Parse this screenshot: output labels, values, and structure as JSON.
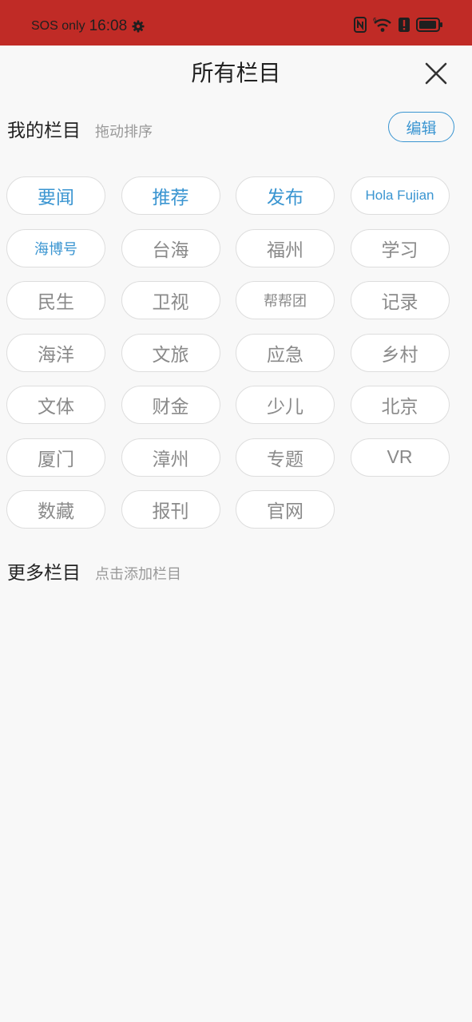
{
  "status_bar": {
    "carrier": "SOS only",
    "time": "16:08"
  },
  "header": {
    "title": "所有栏目"
  },
  "my_channels": {
    "title": "我的栏目",
    "hint": "拖动排序",
    "edit_label": "编辑",
    "items": [
      {
        "label": "要闻",
        "active": true
      },
      {
        "label": "推荐",
        "active": true
      },
      {
        "label": "发布",
        "active": true
      },
      {
        "label": "Hola Fujian",
        "active": true
      },
      {
        "label": "海博号",
        "active": true
      },
      {
        "label": "台海",
        "active": false
      },
      {
        "label": "福州",
        "active": false
      },
      {
        "label": "学习",
        "active": false
      },
      {
        "label": "民生",
        "active": false
      },
      {
        "label": "卫视",
        "active": false
      },
      {
        "label": "帮帮团",
        "active": false
      },
      {
        "label": "记录",
        "active": false
      },
      {
        "label": "海洋",
        "active": false
      },
      {
        "label": "文旅",
        "active": false
      },
      {
        "label": "应急",
        "active": false
      },
      {
        "label": "乡村",
        "active": false
      },
      {
        "label": "文体",
        "active": false
      },
      {
        "label": "财金",
        "active": false
      },
      {
        "label": "少儿",
        "active": false
      },
      {
        "label": "北京",
        "active": false
      },
      {
        "label": "厦门",
        "active": false
      },
      {
        "label": "漳州",
        "active": false
      },
      {
        "label": "专题",
        "active": false
      },
      {
        "label": "VR",
        "active": false
      },
      {
        "label": "数藏",
        "active": false
      },
      {
        "label": "报刊",
        "active": false
      },
      {
        "label": "官网",
        "active": false
      }
    ]
  },
  "more_channels": {
    "title": "更多栏目",
    "hint": "点击添加栏目"
  },
  "colors": {
    "status_bar_bg": "#c02b26",
    "accent": "#3a95d1",
    "chip_text": "#8a8a8a",
    "chip_border": "#dddddd",
    "page_bg": "#f8f8f8"
  },
  "icons": [
    "gear-icon",
    "nfc-icon",
    "wifi-icon",
    "alert-icon",
    "battery-icon",
    "close-icon"
  ]
}
